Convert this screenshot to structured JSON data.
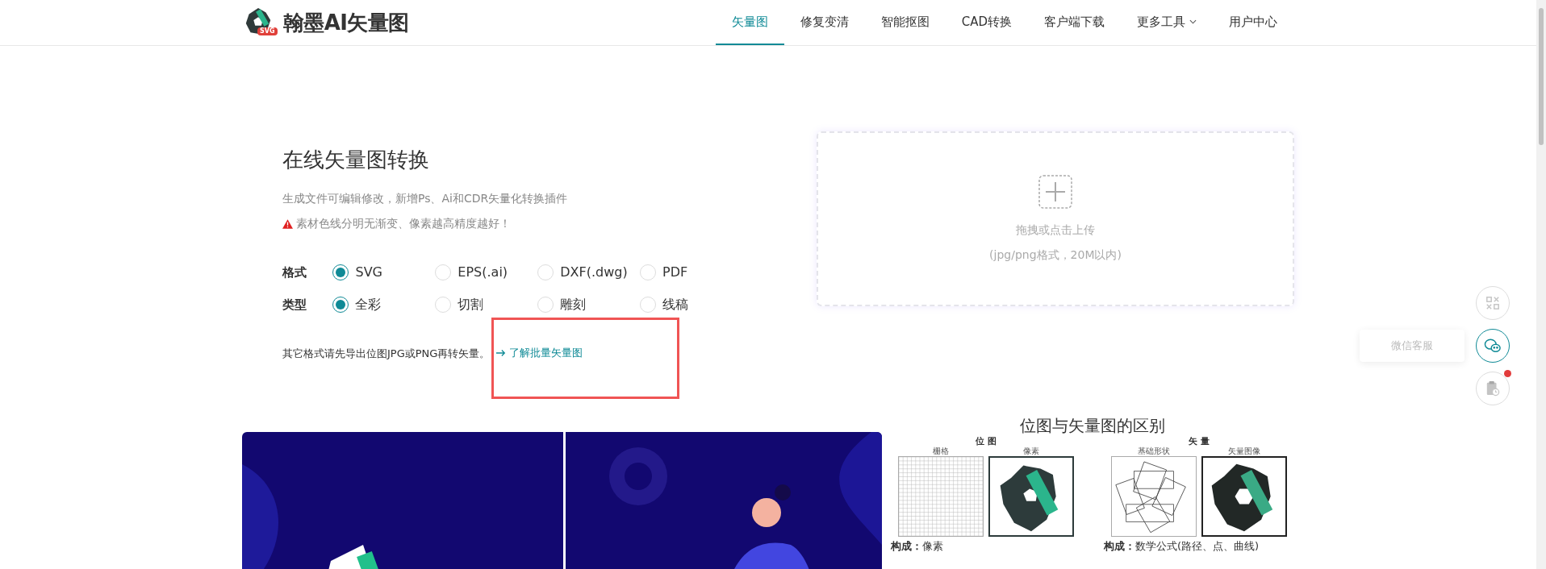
{
  "header": {
    "logo_text": "翰墨AI矢量图",
    "logo_badge": "SVG",
    "nav": [
      {
        "label": "矢量图",
        "selected": true,
        "dropdown": false
      },
      {
        "label": "修复变清",
        "selected": false,
        "dropdown": false
      },
      {
        "label": "智能抠图",
        "selected": false,
        "dropdown": false
      },
      {
        "label": "CAD转换",
        "selected": false,
        "dropdown": false
      },
      {
        "label": "客户端下载",
        "selected": false,
        "dropdown": false
      },
      {
        "label": "更多工具",
        "selected": false,
        "dropdown": true
      },
      {
        "label": "用户中心",
        "selected": false,
        "dropdown": false
      }
    ]
  },
  "intro": {
    "title": "在线矢量图转换",
    "subtitle": "生成文件可编辑修改，新增Ps、Ai和CDR矢量化转换插件",
    "warning": "素材色线分明无渐变、像素越高精度越好！"
  },
  "options": [
    {
      "label": "格式",
      "choices": [
        {
          "label": "SVG",
          "selected": true
        },
        {
          "label": "EPS(.ai)",
          "selected": false
        },
        {
          "label": "DXF(.dwg)",
          "selected": false
        },
        {
          "label": "PDF",
          "selected": false
        }
      ]
    },
    {
      "label": "类型",
      "choices": [
        {
          "label": "全彩",
          "selected": true
        },
        {
          "label": "切割",
          "selected": false
        },
        {
          "label": "雕刻",
          "selected": false
        },
        {
          "label": "线稿",
          "selected": false
        }
      ]
    }
  ],
  "note": {
    "text": "其它格式请先导出位图JPG或PNG再转矢量。",
    "link": "了解批量矢量图"
  },
  "upload": {
    "title": "拖拽或点击上传",
    "hint": "(jpg/png格式，20M以内)"
  },
  "comparison": {
    "title": "位图与矢量图的区别",
    "panels": [
      {
        "heading": "位 图",
        "left_caption": "栅格",
        "right_caption": "像素",
        "kind": "bitmap",
        "label": "构成：",
        "value": "像素"
      },
      {
        "heading": "矢 量",
        "left_caption": "基础形状",
        "right_caption": "矢量图像",
        "kind": "vector",
        "label": "构成：",
        "value": "数学公式(路径、点、曲线)"
      }
    ]
  },
  "side_tools": [
    {
      "kind": "qr",
      "selected": false
    },
    {
      "kind": "chat",
      "tooltip": "微信客服",
      "selected": true
    },
    {
      "kind": "clipboard",
      "selected": false,
      "badge": true
    }
  ]
}
